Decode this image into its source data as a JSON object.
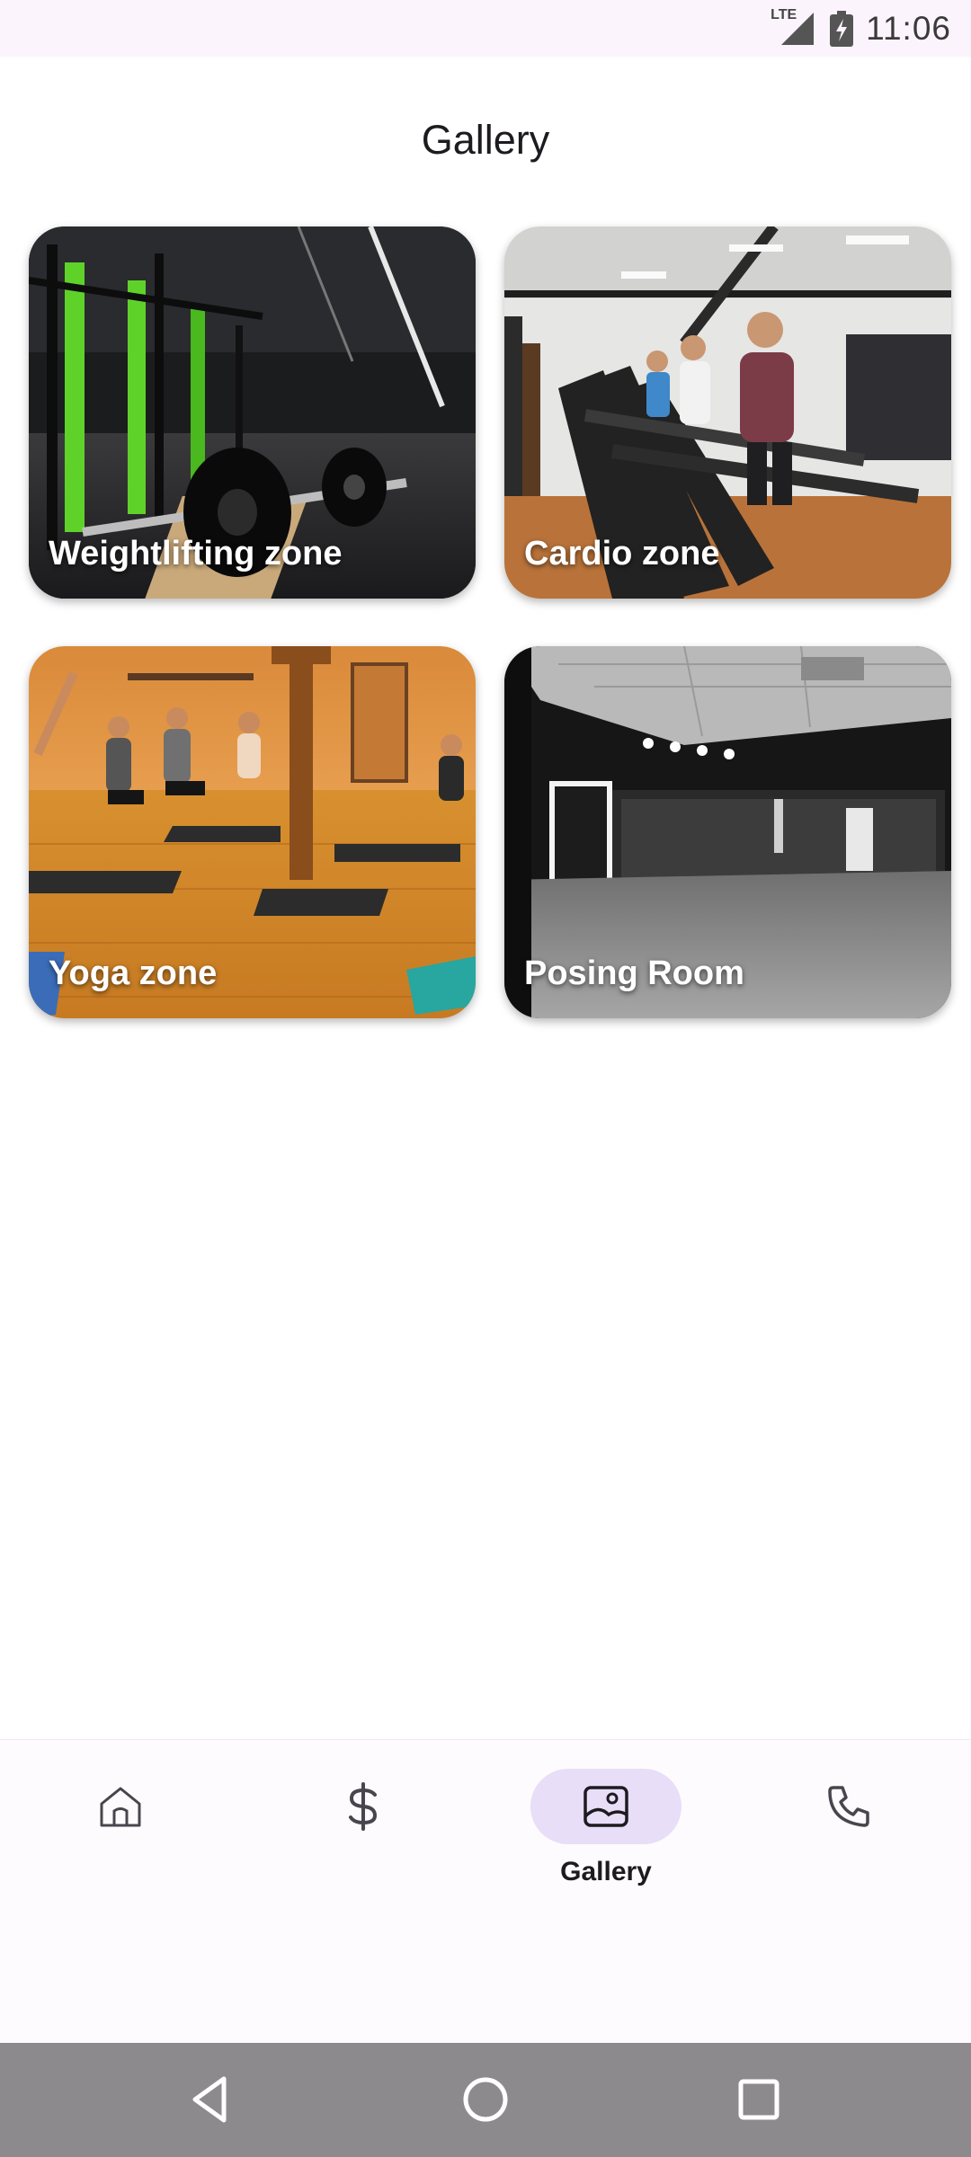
{
  "status_bar": {
    "time": "11:06",
    "network": "LTE",
    "icons": [
      "signal-icon",
      "battery-charging-icon"
    ]
  },
  "header": {
    "title": "Gallery"
  },
  "gallery": {
    "items": [
      {
        "label": "Weightlifting zone",
        "image": "weightlifting-gym-photo"
      },
      {
        "label": "Cardio zone",
        "image": "treadmill-room-photo"
      },
      {
        "label": "Yoga zone",
        "image": "yoga-class-photo"
      },
      {
        "label": "Posing Room",
        "image": "mirror-room-photo"
      }
    ]
  },
  "bottom_nav": {
    "items": [
      {
        "icon": "home-icon",
        "label": ""
      },
      {
        "icon": "dollar-icon",
        "label": ""
      },
      {
        "icon": "gallery-icon",
        "label": "Gallery",
        "active": true
      },
      {
        "icon": "phone-icon",
        "label": ""
      }
    ]
  },
  "system_nav": {
    "icons": [
      "back-icon",
      "home-circle-icon",
      "recents-icon"
    ]
  },
  "colors": {
    "accent_pill": "#e8def8",
    "status_bar_bg": "#fcf4fc",
    "system_nav_bg": "#8d8a8e"
  }
}
